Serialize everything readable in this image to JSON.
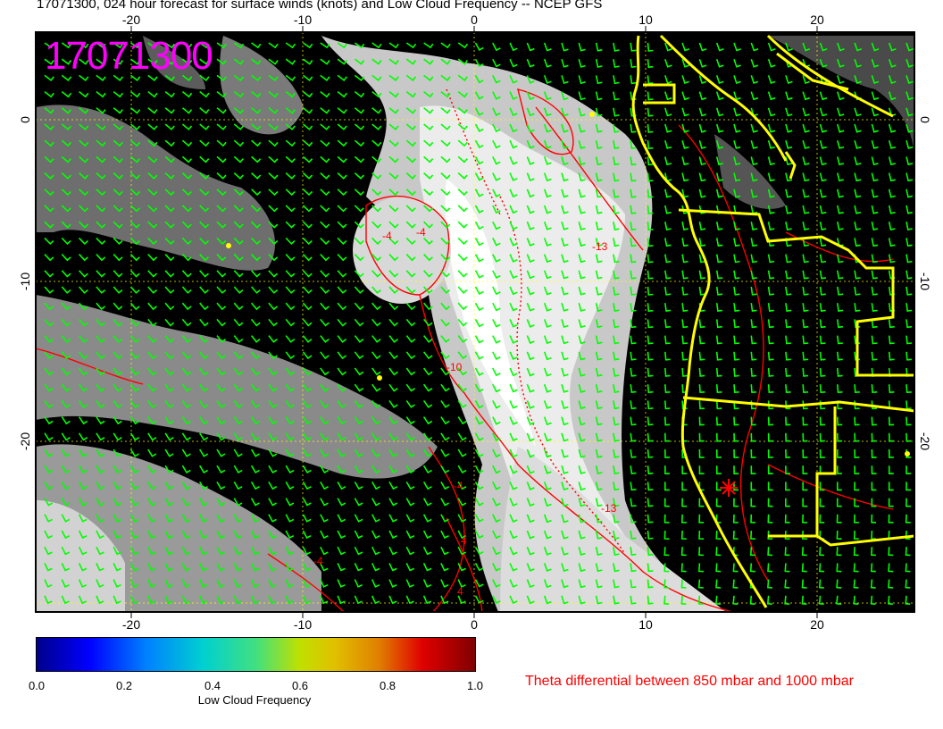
{
  "title": "17071300, 024 hour forecast for surface winds (knots) and Low Cloud Frequency -- NCEP GFS",
  "stamp": "17071300",
  "axes": {
    "top_ticks": [
      "-20",
      "-10",
      "0",
      "10",
      "20"
    ],
    "bottom_ticks": [
      "-20",
      "-10",
      "0",
      "10",
      "20"
    ],
    "left_ticks": [
      "0",
      "-10",
      "-20"
    ],
    "right_ticks": [
      "0",
      "-10",
      "-20"
    ]
  },
  "contour_labels": [
    "-4",
    "-4",
    "-13",
    "-10",
    "-4",
    "-13",
    "4",
    "-4",
    "4"
  ],
  "colorbar": {
    "tick_labels": [
      "0.0",
      "0.2",
      "0.4",
      "0.6",
      "0.8",
      "1.0"
    ],
    "title": "Low Cloud Frequency"
  },
  "contour_note": "Theta differential between 850 mbar and 1000 mbar",
  "colors": {
    "ocean": "#000000",
    "cloud": "#e8e8e8",
    "coast": "#ffff00",
    "contour": "#ff0000",
    "barb": "#00ff00",
    "stamp": "#ff00ff"
  }
}
